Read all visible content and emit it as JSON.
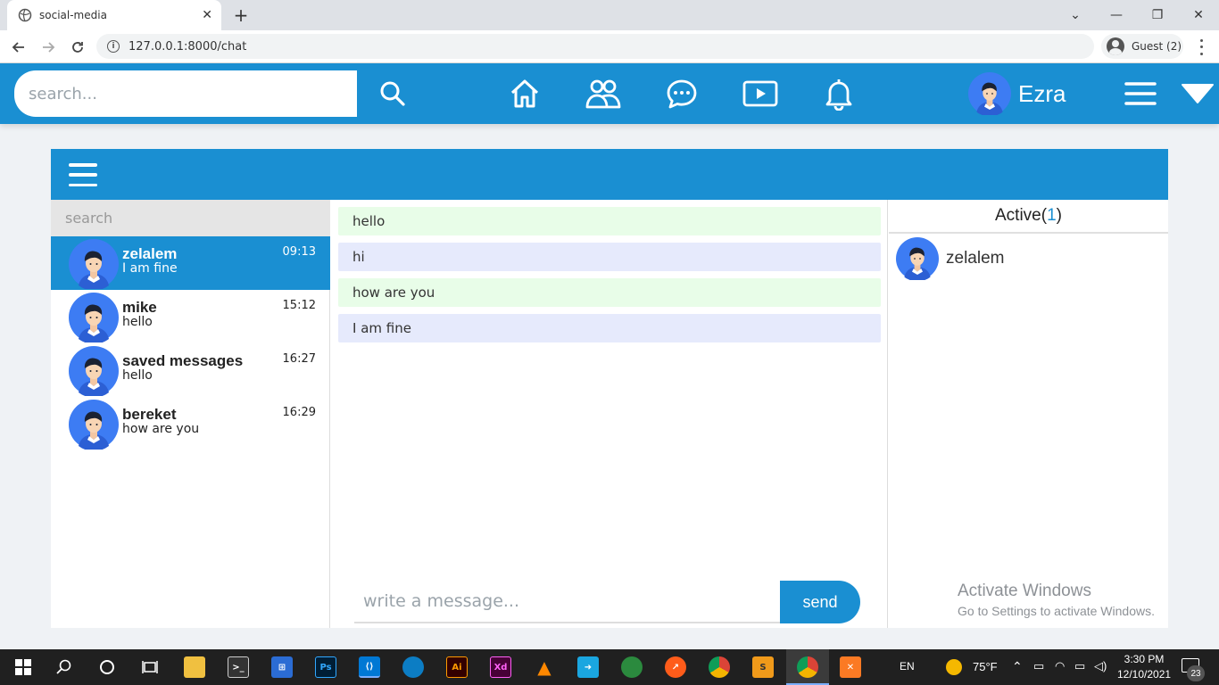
{
  "browser": {
    "tab_title": "social-media",
    "url": "127.0.0.1:8000/chat",
    "profile_label": "Guest (2)"
  },
  "header": {
    "search_placeholder": "search...",
    "user_name": "Ezra"
  },
  "sidebar": {
    "search_placeholder": "search",
    "conversations": [
      {
        "name": "zelalem",
        "last_message": "I am fine",
        "time": "09:13"
      },
      {
        "name": "mike",
        "last_message": "hello",
        "time": "15:12"
      },
      {
        "name": "saved messages",
        "last_message": "hello",
        "time": "16:27"
      },
      {
        "name": "bereket",
        "last_message": "how are you",
        "time": "16:29"
      }
    ]
  },
  "chat": {
    "messages": [
      {
        "text": "hello",
        "direction": "in"
      },
      {
        "text": "hi",
        "direction": "out"
      },
      {
        "text": "how are you",
        "direction": "in"
      },
      {
        "text": "I am fine",
        "direction": "out"
      }
    ],
    "input_placeholder": "write a message...",
    "send_label": "send"
  },
  "active": {
    "title": "Active",
    "count": "1",
    "users": [
      {
        "name": "zelalem"
      }
    ]
  },
  "watermark": {
    "line1": "Activate Windows",
    "line2": "Go to Settings to activate Windows."
  },
  "taskbar": {
    "lang": "EN",
    "weather": "75°F",
    "time": "3:30 PM",
    "date": "12/10/2021",
    "notification_count": "23"
  },
  "colors": {
    "brand": "#1a8fd2",
    "incoming_bg": "#e8fde8",
    "outgoing_bg": "#e6eafc"
  }
}
